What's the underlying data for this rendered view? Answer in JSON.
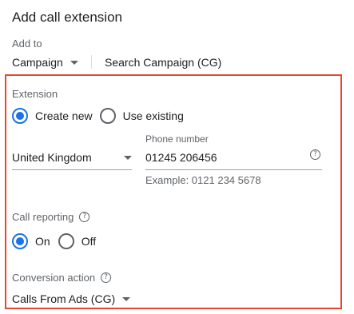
{
  "dialog": {
    "title": "Add call extension"
  },
  "add_to": {
    "label": "Add to",
    "level_value": "Campaign",
    "campaign_name": "Search Campaign (CG)"
  },
  "extension": {
    "label": "Extension",
    "options": [
      {
        "label": "Create new",
        "checked": true
      },
      {
        "label": "Use existing",
        "checked": false
      }
    ]
  },
  "phone": {
    "country_value": "United Kingdom",
    "number_label": "Phone number",
    "number_value": "01245 206456",
    "example": "Example: 0121 234 5678",
    "help_icon": "question-circle-icon"
  },
  "call_reporting": {
    "label": "Call reporting",
    "help_icon": "question-circle-icon",
    "options": [
      {
        "label": "On",
        "checked": true
      },
      {
        "label": "Off",
        "checked": false
      }
    ]
  },
  "conversion_action": {
    "label": "Conversion action",
    "help_icon": "question-circle-icon",
    "value": "Calls From Ads (CG)"
  },
  "colors": {
    "accent": "#1a73e8",
    "highlight_border": "#e8472d"
  }
}
